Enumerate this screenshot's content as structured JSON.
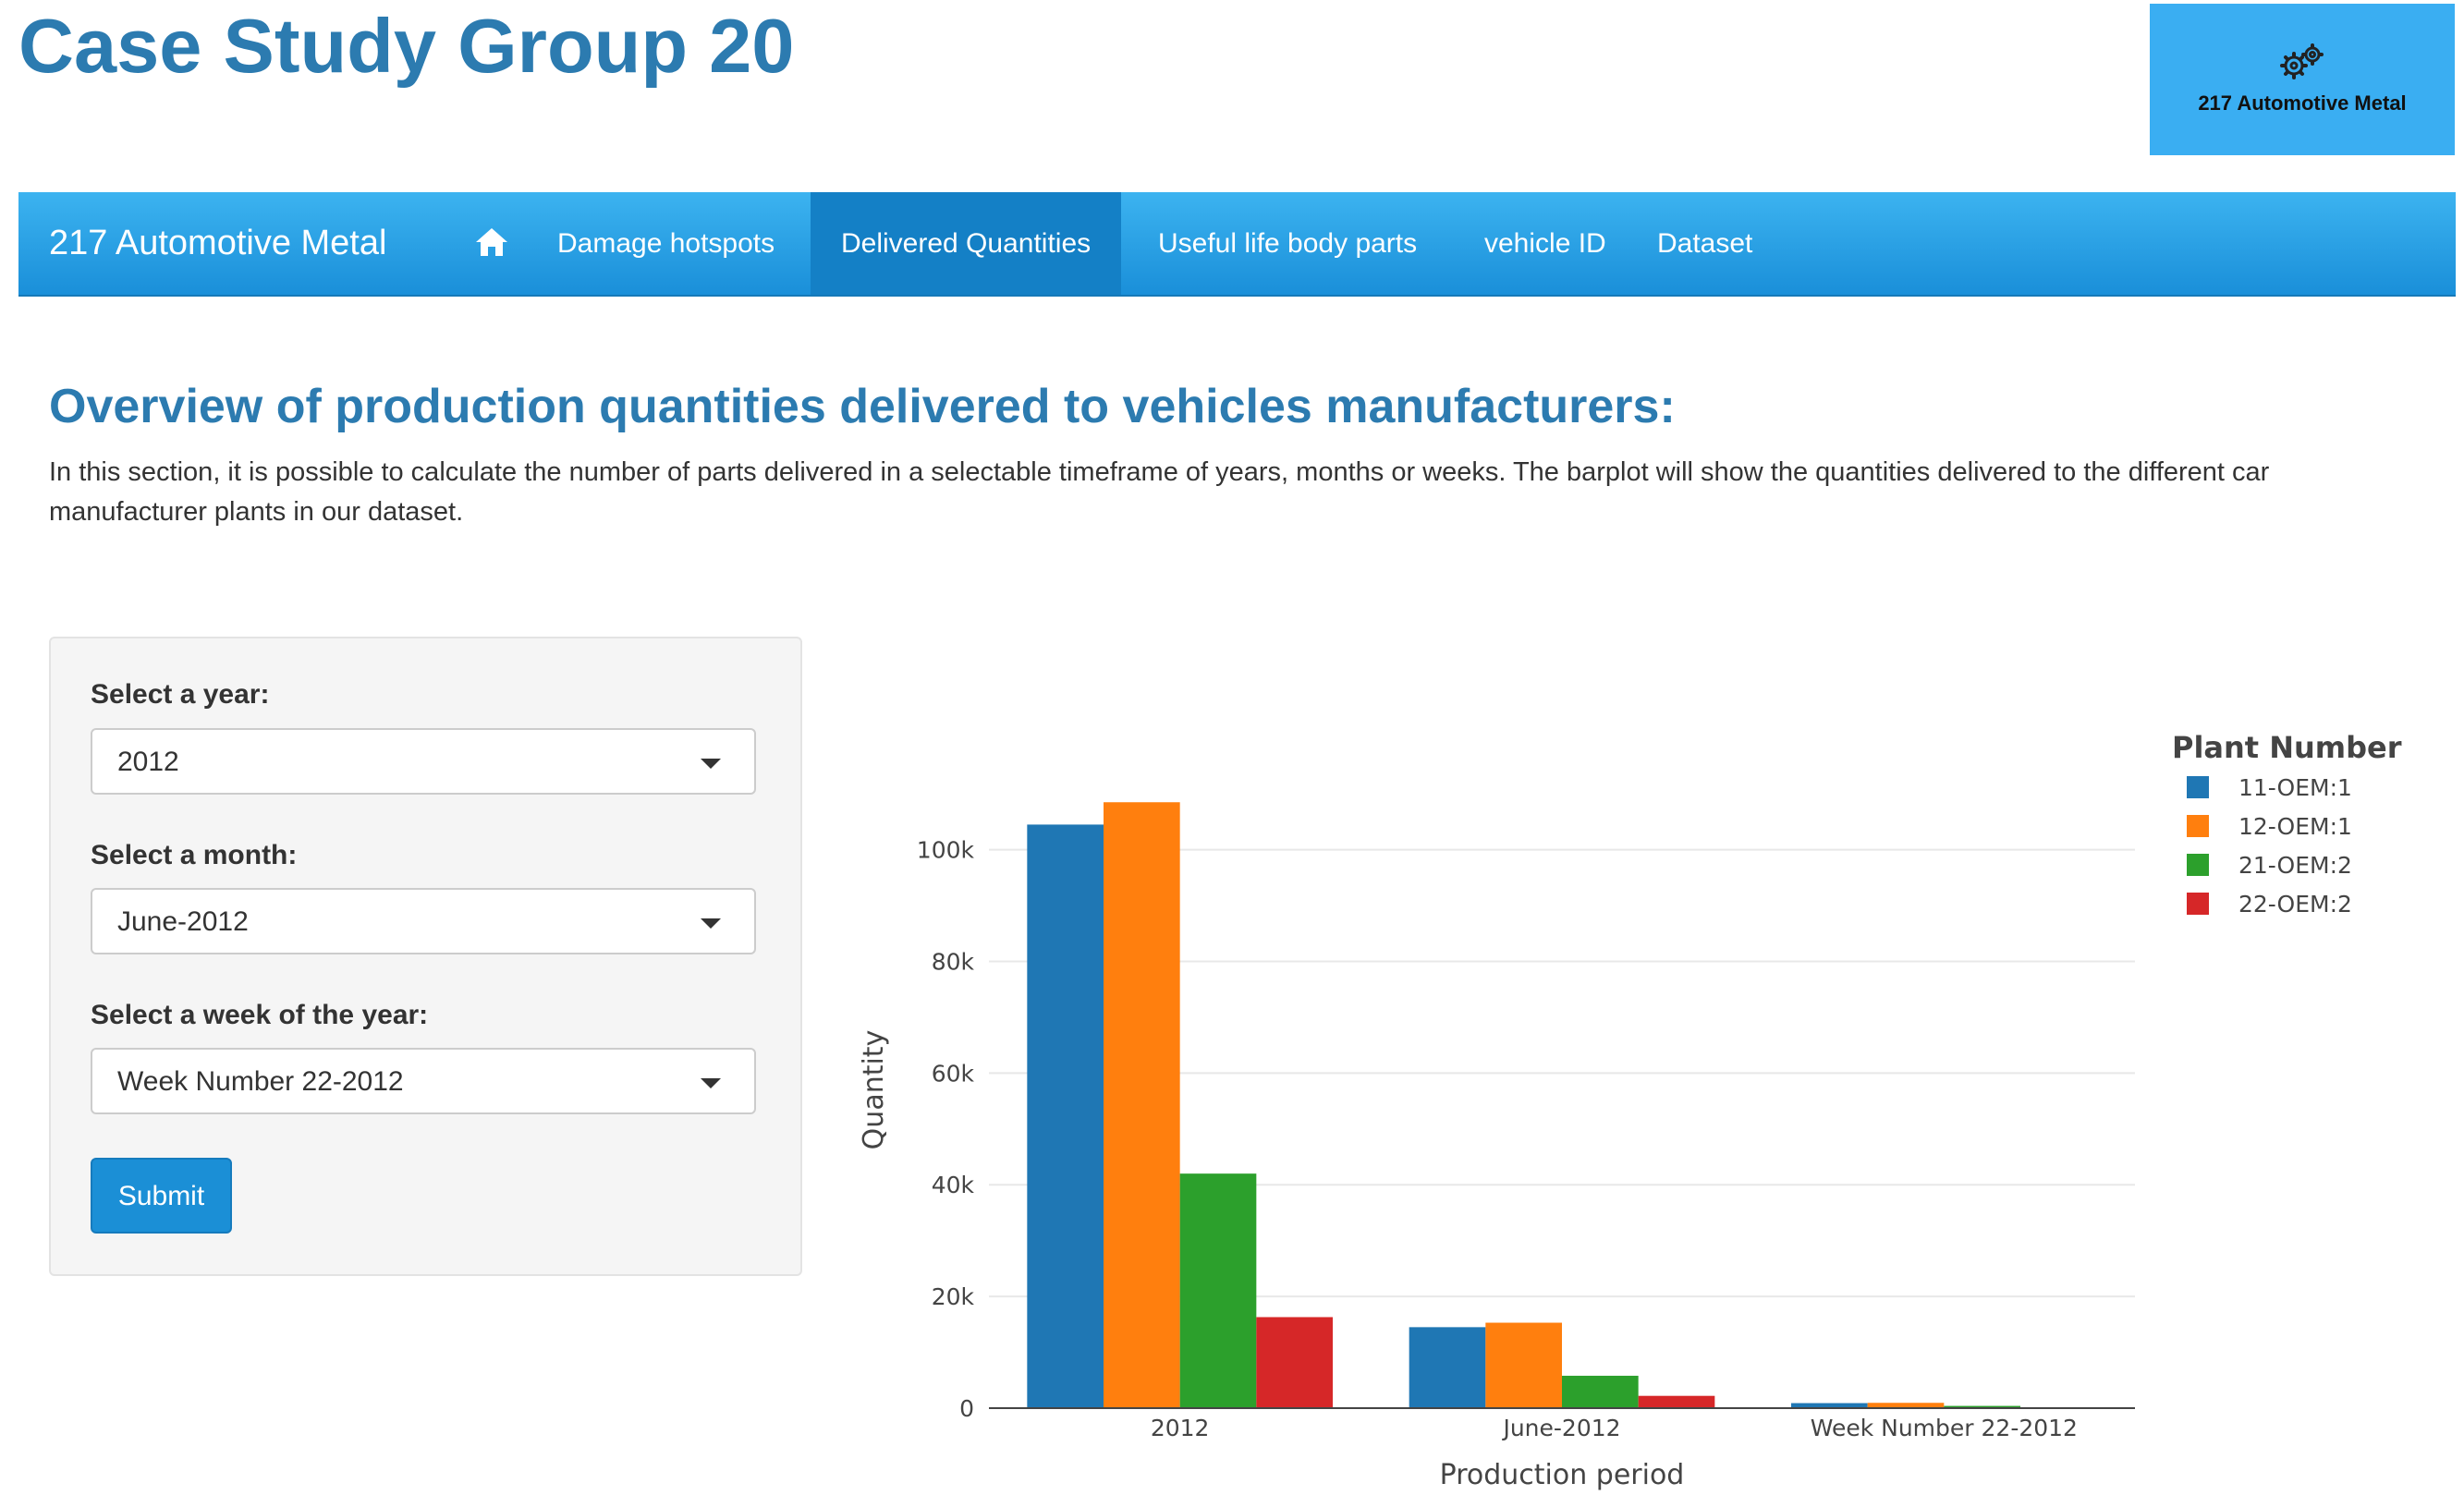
{
  "page_title": "Case Study Group 20",
  "logo": {
    "icon": "gears-icon",
    "text": "217 Automotive Metal"
  },
  "navbar": {
    "brand": "217 Automotive Metal",
    "home_icon": "home-icon",
    "tabs": [
      {
        "label": "Damage hotspots",
        "active": false
      },
      {
        "label": "Delivered Quantities",
        "active": true
      },
      {
        "label": "Useful life body parts",
        "active": false
      },
      {
        "label": "vehicle ID",
        "active": false
      },
      {
        "label": "Dataset",
        "active": false
      }
    ]
  },
  "section": {
    "heading": "Overview of production quantities delivered to vehicles manufacturers:",
    "description": "In this section, it is possible to calculate the number of parts delivered in a selectable timeframe of years, months or weeks. The barplot will show the quantities delivered to the different car manufacturer plants in our dataset."
  },
  "form": {
    "year_label": "Select a year:",
    "year_value": "2012",
    "month_label": "Select a month:",
    "month_value": "June-2012",
    "week_label": "Select a week of the year:",
    "week_value": "Week Number 22-2012",
    "submit_label": "Submit"
  },
  "colors": {
    "accent": "#2c7bb0",
    "navbar": "#1a8fd9",
    "logo_bg": "#3aaef2"
  },
  "chart_data": {
    "type": "bar",
    "categories": [
      "2012",
      "June-2012",
      "Week Number 22-2012"
    ],
    "series": [
      {
        "name": "11-OEM:1",
        "color": "#1f77b4",
        "values": [
          104500,
          14500,
          900
        ]
      },
      {
        "name": "12-OEM:1",
        "color": "#ff7f0e",
        "values": [
          108500,
          15300,
          950
        ]
      },
      {
        "name": "21-OEM:2",
        "color": "#2ca02c",
        "values": [
          42000,
          5800,
          400
        ]
      },
      {
        "name": "22-OEM:2",
        "color": "#d62728",
        "values": [
          16300,
          2200,
          150
        ]
      }
    ],
    "xlabel": "Production period",
    "ylabel": "Quantity",
    "yticks": [
      0,
      20000,
      40000,
      60000,
      80000,
      100000
    ],
    "ytick_labels": [
      "0",
      "20k",
      "40k",
      "60k",
      "80k",
      "100k"
    ],
    "ylim": [
      0,
      114000
    ],
    "legend_title": "Plant Number",
    "legend_position": "top-right",
    "grid": true
  }
}
